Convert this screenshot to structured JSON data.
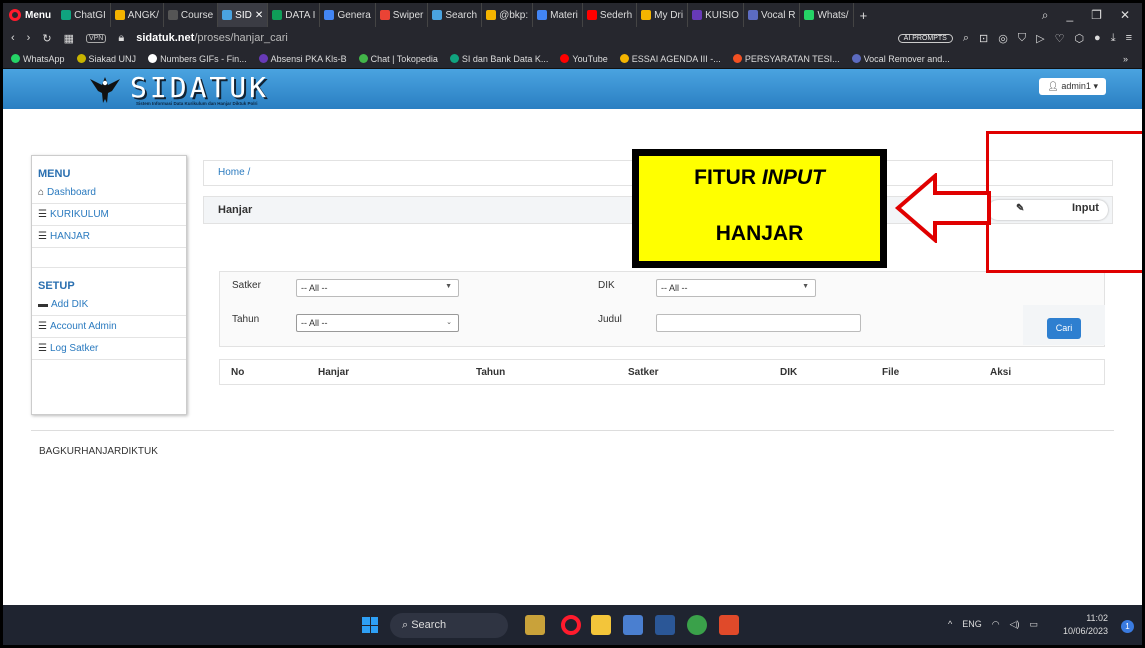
{
  "browser": {
    "menu_label": "Menu",
    "tabs": [
      {
        "label": "ChatGI",
        "color": "#10a37f"
      },
      {
        "label": "ANGK/",
        "color": "#f4b400"
      },
      {
        "label": "Course",
        "color": "#555555"
      },
      {
        "label": "SID",
        "color": "#4aa3e0"
      },
      {
        "label": "DATA I",
        "color": "#0f9d58"
      },
      {
        "label": "Genera",
        "color": "#4285f4"
      },
      {
        "label": "Swiper",
        "color": "#ea4335"
      },
      {
        "label": "Search",
        "color": "#4aa3e0"
      },
      {
        "label": "@bkp:",
        "color": "#f4b400"
      },
      {
        "label": "Materi",
        "color": "#4285f4"
      },
      {
        "label": "Sederh",
        "color": "#ff0000"
      },
      {
        "label": "My Dri",
        "color": "#f4b400"
      },
      {
        "label": "KUISIO",
        "color": "#673ab7"
      },
      {
        "label": "Vocal R",
        "color": "#5c6bc0"
      },
      {
        "label": "Whats/",
        "color": "#25d366"
      }
    ],
    "url_domain": "sidatuk.net",
    "url_path": "/proses/hanjar_cari",
    "vpn_label": "VPN",
    "ai_label": "AI PROMPTS",
    "bookmarks": [
      {
        "label": "WhatsApp",
        "color": "#25d366"
      },
      {
        "label": "Siakad UNJ",
        "color": "#c8b400"
      },
      {
        "label": "Numbers GIFs - Fin...",
        "color": "#ffffff"
      },
      {
        "label": "Absensi PKA Kls-B",
        "color": "#673ab7"
      },
      {
        "label": "Chat | Tokopedia",
        "color": "#42b549"
      },
      {
        "label": "SI dan Bank Data K...",
        "color": "#10a37f"
      },
      {
        "label": "YouTube",
        "color": "#ff0000"
      },
      {
        "label": "ESSAI AGENDA III -...",
        "color": "#f4b400"
      },
      {
        "label": "PERSYARATAN TESI...",
        "color": "#f25022"
      },
      {
        "label": "Vocal Remover and...",
        "color": "#5c6bc0"
      }
    ]
  },
  "site": {
    "logo": "SIDATUK",
    "logo_sub": "Sistem Informasi Data Kurikulum dan Hanjar Diktuk Polri",
    "user": "admin1"
  },
  "sidebar": {
    "menu_title": "MENU",
    "menu_items": [
      {
        "icon": "home-icon",
        "glyph": "⌂",
        "label": "Dashboard"
      },
      {
        "icon": "list-icon",
        "glyph": "☰",
        "label": "KURIKULUM"
      },
      {
        "icon": "list-icon",
        "glyph": "☰",
        "label": "HANJAR"
      }
    ],
    "setup_title": "SETUP",
    "setup_items": [
      {
        "icon": "comment-icon",
        "glyph": "▬",
        "label": "Add DIK"
      },
      {
        "icon": "list-icon",
        "glyph": "☰",
        "label": "Account Admin"
      },
      {
        "icon": "log-icon",
        "glyph": "☰",
        "label": "Log Satker"
      }
    ]
  },
  "main": {
    "breadcrumb": "Home  /",
    "section_title": "Hanjar",
    "input_button": "Input",
    "filters": {
      "satker_label": "Satker",
      "satker_value": "-- All --",
      "dik_label": "DIK",
      "dik_value": "-- All --",
      "tahun_label": "Tahun",
      "tahun_value": "-- All --",
      "judul_label": "Judul",
      "judul_value": "",
      "search_button": "Cari"
    },
    "table_headers": [
      "No",
      "Hanjar",
      "Tahun",
      "Satker",
      "DIK",
      "File",
      "Aksi"
    ],
    "footer": "BAGKURHANJARDIKTUK"
  },
  "annotation": {
    "line1_prefix": "FITUR ",
    "line1_italic": "INPUT",
    "line2": "HANJAR",
    "box_color": "#ffff00",
    "arrow_color": "#e00000"
  },
  "taskbar": {
    "search_placeholder": "Search",
    "language": "ENG",
    "time": "11:02",
    "date": "10/06/2023",
    "notification_count": "1"
  }
}
